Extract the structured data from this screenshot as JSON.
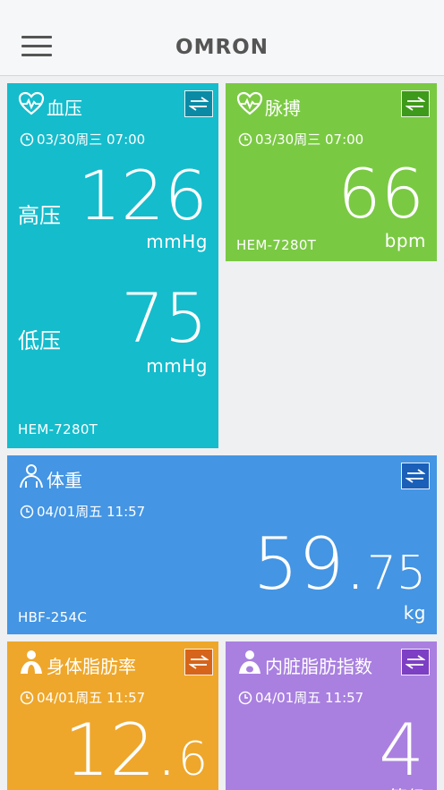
{
  "app": {
    "logo": "OMRON"
  },
  "colors": {
    "bp": "#15bccc",
    "pulse": "#7ac943",
    "weight": "#4495e3",
    "fat": "#eea72b",
    "visceral": "#a980e0"
  },
  "cards": {
    "bp": {
      "title": "血压",
      "datetime": "03/30周三 07:00",
      "systolic_label": "高压",
      "systolic": "126",
      "systolic_unit": "mmHg",
      "diastolic_label": "低压",
      "diastolic": "75",
      "diastolic_unit": "mmHg",
      "device": "HEM-7280T",
      "icon": "heart-pulse-icon"
    },
    "pulse": {
      "title": "脉搏",
      "datetime": "03/30周三 07:00",
      "value": "66",
      "unit": "bpm",
      "device": "HEM-7280T",
      "icon": "heart-pulse-icon"
    },
    "weight": {
      "title": "体重",
      "datetime": "04/01周五 11:57",
      "value_int": "59.",
      "value_dec": "75",
      "unit": "kg",
      "device": "HBF-254C",
      "icon": "person-icon"
    },
    "fat": {
      "title": "身体脂肪率",
      "datetime": "04/01周五 11:57",
      "value_int": "12.",
      "value_dec": "6",
      "icon": "person-body-icon"
    },
    "visceral": {
      "title": "内脏脂肪指数",
      "datetime": "04/01周五 11:57",
      "value": "4",
      "unit_partial": "等级",
      "icon": "person-body-icon"
    }
  }
}
